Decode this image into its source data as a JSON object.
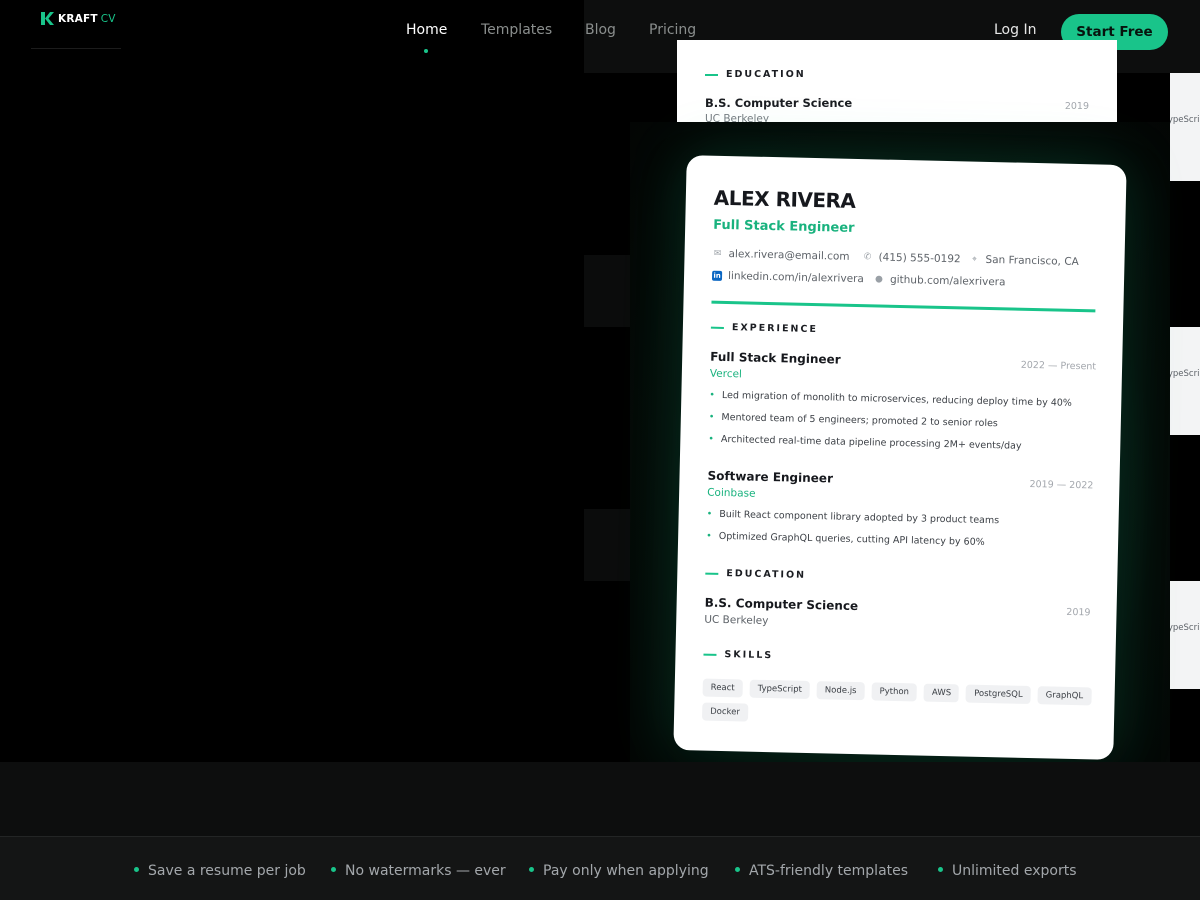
{
  "brand": {
    "name_part1": "KRAFT",
    "name_part2": "CV",
    "accent": "#19c48a",
    "logo_icon": "k-logo-icon"
  },
  "nav": {
    "links": [
      {
        "label": "Home",
        "active": true
      },
      {
        "label": "Templates",
        "active": false
      },
      {
        "label": "Blog",
        "active": false
      },
      {
        "label": "Pricing",
        "active": false
      }
    ],
    "login_label": "Log In",
    "cta_label": "Start Free"
  },
  "peek_card": {
    "section": "EDUCATION",
    "degree": "B.S. Computer Science",
    "school": "UC Berkeley",
    "year": "2019"
  },
  "edge_chip": "TypeScript",
  "resume": {
    "name": "ALEX RIVERA",
    "role": "Full Stack Engineer",
    "contact": {
      "email": "alex.rivera@email.com",
      "phone": "(415) 555-0192",
      "location": "San Francisco, CA",
      "linkedin": "linkedin.com/in/alexrivera",
      "github": "github.com/alexrivera"
    },
    "experience_heading": "EXPERIENCE",
    "jobs": [
      {
        "title": "Full Stack Engineer",
        "company": "Vercel",
        "dates": "2022 — Present",
        "bullets": [
          "Led migration of monolith to microservices, reducing deploy time by 40%",
          "Mentored team of 5 engineers; promoted 2 to senior roles",
          "Architected real-time data pipeline processing 2M+ events/day"
        ]
      },
      {
        "title": "Software Engineer",
        "company": "Coinbase",
        "dates": "2019 — 2022",
        "bullets": [
          "Built React component library adopted by 3 product teams",
          "Optimized GraphQL queries, cutting API latency by 60%"
        ]
      }
    ],
    "education_heading": "EDUCATION",
    "education": {
      "degree": "B.S. Computer Science",
      "school": "UC Berkeley",
      "year": "2019"
    },
    "skills_heading": "SKILLS",
    "skills": [
      "React",
      "TypeScript",
      "Node.js",
      "Python",
      "AWS",
      "PostgreSQL",
      "GraphQL",
      "Docker"
    ]
  },
  "features": [
    "Save a resume per job",
    "No watermarks — ever",
    "Pay only when applying",
    "ATS-friendly templates",
    "Unlimited exports"
  ]
}
